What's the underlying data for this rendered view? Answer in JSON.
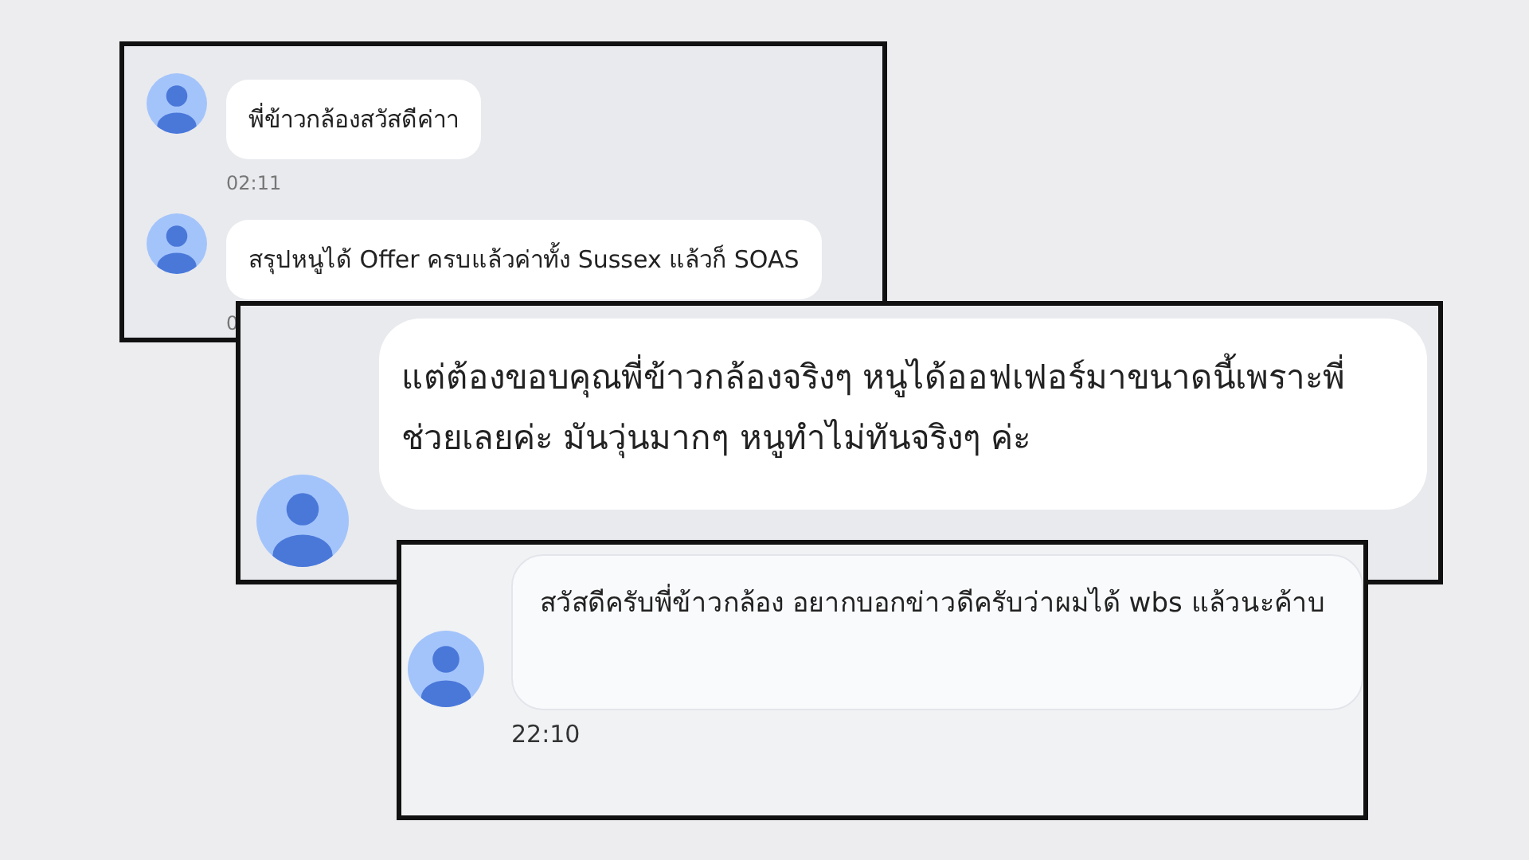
{
  "panels": [
    {
      "kind": "small",
      "messages": [
        {
          "text": "พี่ข้าวกล้องสวัสดีค่าา",
          "time": "02:11"
        },
        {
          "text": "สรุปหนูได้ Offer ครบแล้วค่าทั้ง Sussex แล้วก็ SOAS",
          "time": "0"
        }
      ]
    },
    {
      "kind": "large",
      "messages": [
        {
          "text": "แต่ต้องขอบคุณพี่ข้าวกล้องจริงๆ หนูได้ออฟเฟอร์มาขนาดนี้เพราะพี่ช่วยเลยค่ะ มันวุ่นมากๆ หนูทำไม่ทันจริงๆ ค่ะ"
        }
      ]
    },
    {
      "kind": "medium",
      "messages": [
        {
          "text": "สวัสดีครับพี่ข้าวกล้อง อยากบอกข่าวดีครับว่าผมได้ wbs แล้วนะค้าบ",
          "time": "22:10"
        }
      ]
    }
  ]
}
